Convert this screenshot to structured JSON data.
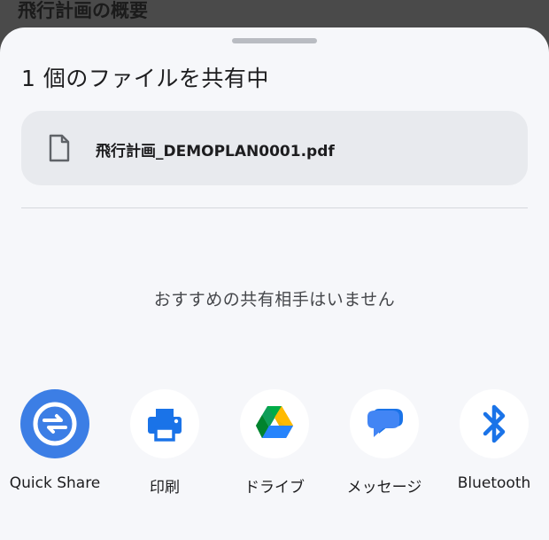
{
  "background": {
    "title": "飛行計画の概要"
  },
  "sheet": {
    "title": "1 個のファイルを共有中",
    "file": {
      "icon": "file-icon",
      "name": "飛行計画_DEMOPLAN0001.pdf"
    },
    "no_recommendations": "おすすめの共有相手はいません",
    "targets": [
      {
        "label": "Quick Share",
        "icon": "quick-share-icon",
        "color": "#3c7ee5"
      },
      {
        "label": "印刷",
        "icon": "printer-icon",
        "color": "#1a73e8"
      },
      {
        "label": "ドライブ",
        "icon": "google-drive-icon",
        "color": "#34a853"
      },
      {
        "label": "メッセージ",
        "icon": "messages-icon",
        "color": "#1a73e8"
      },
      {
        "label": "Bluetooth",
        "icon": "bluetooth-icon",
        "color": "#1a73e8"
      }
    ]
  },
  "colors": {
    "sheet_background": "#f6f7fa",
    "file_card_background": "#e8eaee",
    "scrim": "#4a4a4a"
  }
}
